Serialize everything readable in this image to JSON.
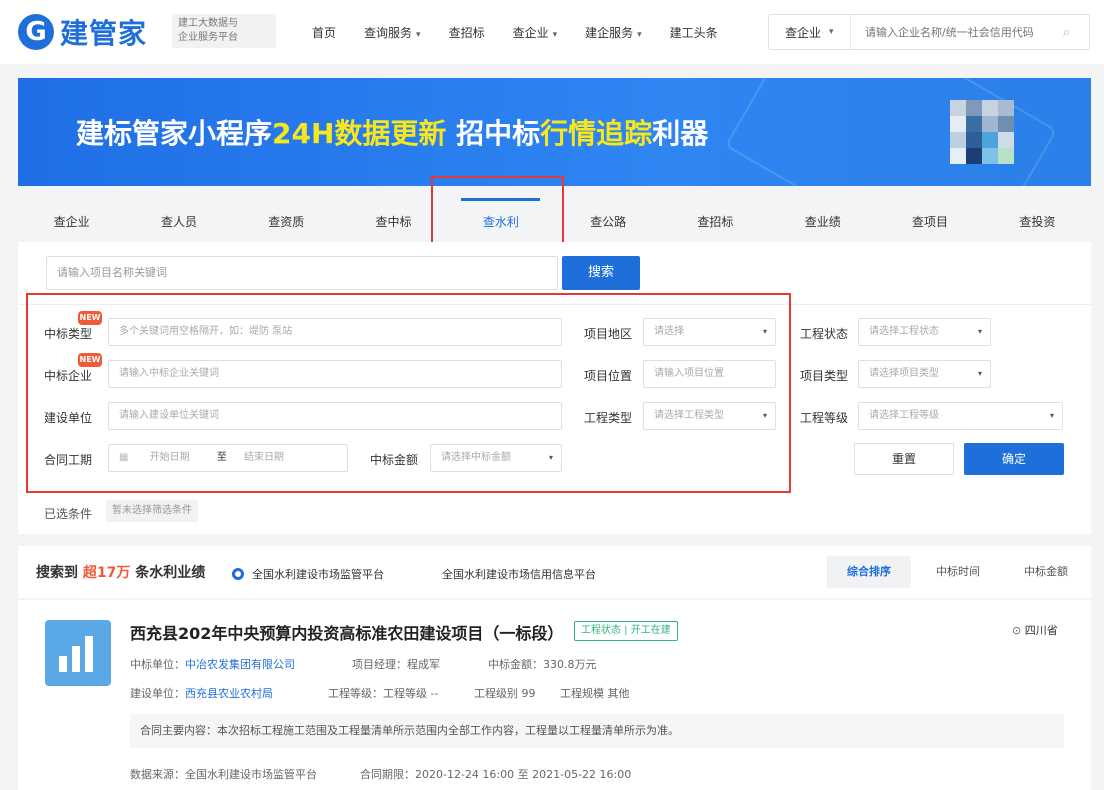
{
  "header": {
    "logo_mark": "G",
    "logo_text": "建管家",
    "slogan_line1": "建工大数据与",
    "slogan_line2": "企业服务平台",
    "nav": [
      {
        "label": "首页",
        "has_caret": false
      },
      {
        "label": "查询服务",
        "has_caret": true
      },
      {
        "label": "查招标",
        "has_caret": false
      },
      {
        "label": "查企业",
        "has_caret": true
      },
      {
        "label": "建企服务",
        "has_caret": true
      },
      {
        "label": "建工头条",
        "has_caret": false
      }
    ],
    "search_type": "查企业",
    "search_placeholder": "请输入企业名称/统一社会信用代码"
  },
  "banner": {
    "part1": "建标管家小程序",
    "part2": "24H数据更新",
    "part3": "  招中标",
    "part4": "行情追踪",
    "part5": "利器"
  },
  "tabs": [
    "查企业",
    "查人员",
    "查资质",
    "查中标",
    "查水利",
    "查公路",
    "查招标",
    "查业绩",
    "查项目",
    "查投资"
  ],
  "active_tab": 4,
  "filter": {
    "project_placeholder": "请输入项目名称关键词",
    "search_button": "搜索",
    "badge": "NEW",
    "labels": {
      "bid_type": "中标类型",
      "bid_company": "中标企业",
      "builder": "建设单位",
      "contract_period": "合同工期",
      "bid_amount": "中标金额",
      "project_region": "项目地区",
      "project_location": "项目位置",
      "project_category": "工程类型",
      "source": "工程状态",
      "project_type": "项目类型",
      "project_grade": "工程等级"
    },
    "fields": {
      "bid_type": "多个关键词用空格隔开，如：堤防 泵站",
      "bid_company": "请输入中标企业关键词",
      "builder": "请输入建设单位关键词",
      "date_start": "开始日期",
      "date_sep": "至",
      "date_end": "结束日期",
      "bid_amount": "请选择中标金额",
      "project_region": "请选择",
      "project_location": "请输入项目位置",
      "project_category": "请选择工程类型",
      "source": "请选择工程状态",
      "project_type": "请选择项目类型",
      "project_grade": "请选择工程等级"
    },
    "reset_button": "重置",
    "ok_button": "确定",
    "selected_label": "已选条件",
    "selected_tag": "暂未选择筛选条件"
  },
  "results": {
    "prefix": "搜索到",
    "count": "超17万",
    "suffix": "条水利业绩",
    "radio1": "全国水利建设市场监管平台",
    "radio2": "全国水利建设市场信用信息平台",
    "sort": [
      "综合排序",
      "中标时间",
      "中标金额"
    ],
    "item": {
      "title": "西充县202年中央预算内投资高标准农田建设项目（一标段）",
      "tag": "工程状态 | 开工在建",
      "location": "四川省",
      "row1_label": "中标单位：",
      "row1_link": "中冶农发集团有限公司",
      "row1_b": "项目经理：程成军",
      "row1_c": "中标金额：330.8万元",
      "row2_label": "建设单位：",
      "row2_link": "西充县农业农村局",
      "row2_b": "工程等级：工程等级 --",
      "row2_c": "工程级别 99",
      "row2_d": "工程规模 其他",
      "content": "合同主要内容：本次招标工程施工范围及工程量清单所示范围内全部工作内容，工程量以工程量清单所示为准。",
      "row3_a": "数据来源：全国水利建设市场监管平台",
      "row3_b": "合同期限：2020-12-24 16:00 至 2021-05-22 16:00"
    }
  },
  "colors": {
    "brand": "#1e6fd9",
    "highlight": "#f8e71c",
    "badge": "#f05a3a",
    "tag": "#35b37e",
    "annotation": "#e53935"
  }
}
